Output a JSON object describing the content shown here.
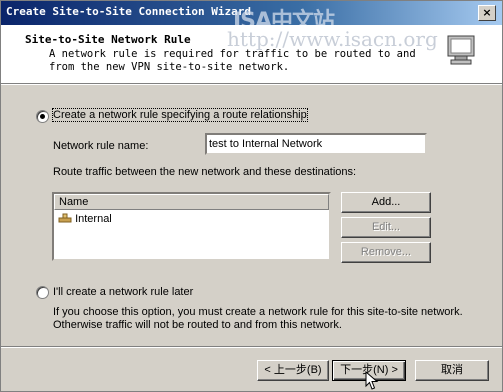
{
  "window": {
    "title": "Create Site-to-Site Connection Wizard",
    "watermark_top": "ISA中文站",
    "watermark_url": "http://www.isacn.org",
    "close_glyph": "×"
  },
  "header": {
    "title": "Site-to-Site Network Rule",
    "description": "A network rule is required for traffic to be routed to and from the new VPN site-to-site network."
  },
  "option_create": {
    "label": "Create a network rule specifying a route relationship",
    "selected": true
  },
  "rule_name": {
    "label": "Network rule name:",
    "value": "test to Internal Network"
  },
  "route_text": "Route traffic between the new network and these destinations:",
  "destinations": {
    "column_header": "Name",
    "items": [
      "Internal"
    ]
  },
  "side_buttons": {
    "add": "Add...",
    "edit": "Edit...",
    "remove": "Remove..."
  },
  "option_later": {
    "label": "I'll create a network rule later",
    "selected": false,
    "description_line1": "If you choose this option, you must create a network rule for this site-to-site network.",
    "description_line2": "Otherwise traffic will not be routed to and from this network."
  },
  "footer": {
    "back": "< 上一步(B)",
    "next": "下一步(N) >",
    "cancel": "取消"
  },
  "colors": {
    "titlebar_start": "#0a246a",
    "face": "#d4d0c8"
  }
}
